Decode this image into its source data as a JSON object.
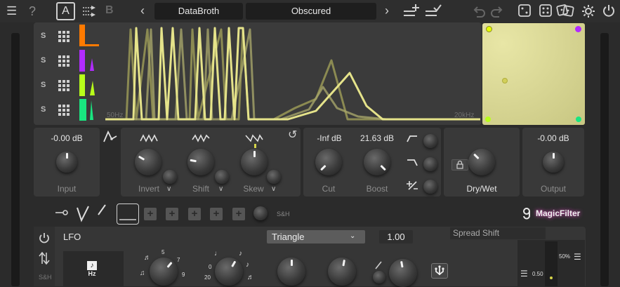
{
  "toolbar": {
    "help": "?",
    "slot_a": "A",
    "slot_b": "B",
    "prev": "‹",
    "next": "›",
    "preset_bank": "DataBroth",
    "preset_name": "Obscured"
  },
  "bands": [
    {
      "solo": "S",
      "color": "#ff7a00"
    },
    {
      "solo": "S",
      "color": "#b12cff"
    },
    {
      "solo": "S",
      "color": "#b8ff1a"
    },
    {
      "solo": "S",
      "color": "#19e680"
    }
  ],
  "spectrum": {
    "freq_min": "50Hz",
    "freq_max": "20kHz"
  },
  "input": {
    "value": "-0.00 dB",
    "label": "Input"
  },
  "shape": {
    "invert_label": "Invert",
    "shift_label": "Shift",
    "skew_label": "Skew"
  },
  "filter": {
    "cut_value": "-Inf dB",
    "boost_value": "21.63 dB",
    "cut_label": "Cut",
    "boost_label": "Boost"
  },
  "drywet": {
    "label": "Dry/Wet"
  },
  "output": {
    "value": "-0.00 dB",
    "label": "Output"
  },
  "mod": {
    "sh_label": "S&H",
    "brand": "MagicFilter"
  },
  "lfo": {
    "title": "LFO",
    "waveform": "Triangle",
    "amount": "1.00",
    "target": "Spread Shift",
    "hz_label": "Hz",
    "sh_label": "S&H",
    "meter_top": "50%",
    "meter_bottom": "0.50",
    "rate_ticks": [
      "5",
      "7",
      "9"
    ],
    "phase_ticks": [
      "0",
      "20"
    ]
  },
  "colors": {
    "accent": "#e5e38a",
    "xy_pad": "#d6d48a"
  }
}
